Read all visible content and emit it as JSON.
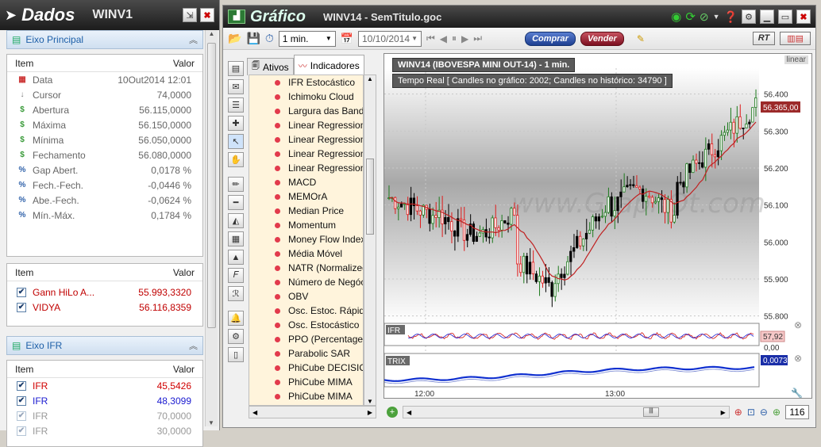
{
  "dados": {
    "title": "Dados",
    "asset": "WINV1",
    "section1": "Eixo Principal",
    "col_item": "Item",
    "col_value": "Valor",
    "rows": [
      {
        "icon": "calendar",
        "label": "Data",
        "value": "10Out2014 12:01"
      },
      {
        "icon": "cursor",
        "label": "Cursor",
        "value": "74,0000"
      },
      {
        "icon": "dollar",
        "label": "Abertura",
        "value": "56.115,0000"
      },
      {
        "icon": "dollar",
        "label": "Máxima",
        "value": "56.150,0000"
      },
      {
        "icon": "dollar",
        "label": "Mínima",
        "value": "56.050,0000"
      },
      {
        "icon": "dollar",
        "label": "Fechamento",
        "value": "56.080,0000"
      },
      {
        "icon": "percent",
        "label": "Gap Abert.",
        "value": "0,0178 %"
      },
      {
        "icon": "percent",
        "label": "Fech.-Fech.",
        "value": "-0,0446 %"
      },
      {
        "icon": "percent",
        "label": "Abe.-Fech.",
        "value": "-0,0624 %"
      },
      {
        "icon": "percent",
        "label": "Mín.-Máx.",
        "value": "0,1784 %"
      }
    ],
    "indicators": [
      {
        "label": "Gann HiLo A...",
        "value": "55.993,3320",
        "color": "#c00000"
      },
      {
        "label": "VIDYA",
        "value": "56.116,8359",
        "color": "#c00000"
      }
    ],
    "section2": "Eixo IFR",
    "ifr_rows": [
      {
        "label": "IFR",
        "value": "45,5426",
        "color": "#d00000",
        "checked": true
      },
      {
        "label": "IFR",
        "value": "48,3099",
        "color": "#1a1ad0",
        "checked": true
      },
      {
        "label": "IFR",
        "value": "70,0000",
        "color": "#999999",
        "checked": false
      },
      {
        "label": "IFR",
        "value": "30,0000",
        "color": "#999999",
        "checked": false
      }
    ]
  },
  "grafico": {
    "title": "Gráfico",
    "doc": "WINV14 - SemTitulo.goc",
    "interval": "1 min.",
    "date": "10/10/2014",
    "buy": "Comprar",
    "sell": "Vender",
    "rt": "RT",
    "tabs": [
      "Ativos",
      "Indicadores"
    ],
    "indicators": [
      "IFR Estocástico",
      "Ichimoku Cloud",
      "Largura das Bandas",
      "Linear Regression",
      "Linear Regression",
      "Linear Regression",
      "Linear Regression",
      "MACD",
      "MEMOrA",
      "Median Price",
      "Momentum",
      "Money Flow Index",
      "Média Móvel",
      "NATR (Normalized)",
      "Número de Negócios",
      "OBV",
      "Osc. Estoc. Rápido",
      "Osc. Estocástico",
      "PPO (Percentage)",
      "Parabolic SAR",
      "PhiCube DECISION",
      "PhiCube MIMA",
      "PhiCube MIMA"
    ],
    "chart_title": "WINV14 (IBOVESPA MINI OUT-14) - 1 min.",
    "chart_info": "Tempo Real  [ Candles no gráfico: 2002; Candles no histórico: 34790 ]",
    "scale_mode": "linear",
    "price_labels": [
      "56.400",
      "56.300",
      "56.200",
      "56.100",
      "56.000",
      "55.900",
      "55.800"
    ],
    "last_price": "56.365,00",
    "ifr_label": "IFR",
    "ifr_value": "57,92",
    "ifr_zero": "0,00",
    "trix_label": "TRIX",
    "trix_value": "0,0073",
    "time_labels": [
      "12:00",
      "13:00"
    ],
    "zoom_value": "116",
    "watermark": "www.GraphOt.com"
  }
}
